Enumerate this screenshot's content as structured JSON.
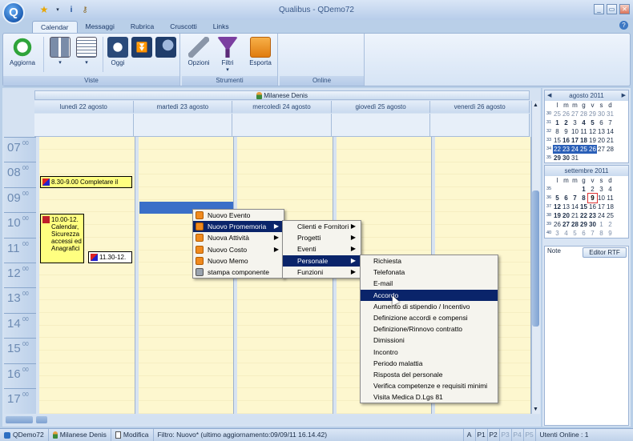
{
  "app": {
    "title": "Qualibus  -  QDemo72",
    "logo_letter": "Q"
  },
  "window_controls": {
    "minimize": "_",
    "restore": "▭",
    "close": "✕"
  },
  "help_label": "?",
  "tabs": [
    {
      "label": "Calendar",
      "active": true
    },
    {
      "label": "Messaggi"
    },
    {
      "label": "Rubrica"
    },
    {
      "label": "Cruscotti"
    },
    {
      "label": "Links"
    }
  ],
  "ribbon": {
    "groups": [
      {
        "label": "Viste"
      },
      {
        "label": "Strumenti"
      },
      {
        "label": "Online"
      }
    ],
    "buttons": {
      "aggiorna": "Aggiorna",
      "oggi": "Oggi",
      "opzioni": "Opzioni",
      "filtri": "Filtri",
      "esporta": "Esporta"
    }
  },
  "resource": "Milanese Denis",
  "days": [
    "lunedì 22 agosto",
    "martedì 23 agosto",
    "mercoledì 24 agosto",
    "giovedì 25 agosto",
    "venerdì 26 agosto"
  ],
  "hours": [
    "07",
    "08",
    "09",
    "10",
    "11",
    "12",
    "13",
    "14",
    "15",
    "16",
    "17"
  ],
  "minutes": "00",
  "events": {
    "e1": "8.30-9.00 Completare il",
    "e2": "10.00-12. Calendar, Sicurezza accessi ed Anagrafici",
    "e3": "11.30-12."
  },
  "context_menu": [
    "Nuovo Evento",
    "Nuovo Promemoria",
    "Nuova Attività",
    "Nuovo Costo",
    "Nuovo Memo",
    "stampa componente"
  ],
  "submenu1": [
    "Clienti e Fornitori",
    "Progetti",
    "Eventi",
    "Personale",
    "Funzioni"
  ],
  "submenu2": [
    "Richiesta",
    "Telefonata",
    "E-mail",
    "Accordo",
    "Aumento di stipendio / Incentivo",
    "Definizione accordi e compensi",
    "Definizione/Rinnovo contratto",
    "Dimissioni",
    "Incontro",
    "Periodo malattia",
    "Risposta del personale",
    "Verifica competenze e requisiti minimi",
    "Visita Medica D.Lgs 81"
  ],
  "mini_cal": {
    "august": {
      "title": "agosto 2011",
      "dow": [
        "l",
        "m",
        "m",
        "g",
        "v",
        "s",
        "d"
      ],
      "weeks": [
        {
          "wk": "30",
          "days": [
            "25",
            "26",
            "27",
            "28",
            "29",
            "30",
            "31"
          ]
        },
        {
          "wk": "31",
          "days": [
            "1",
            "2",
            "3",
            "4",
            "5",
            "6",
            "7"
          ]
        },
        {
          "wk": "32",
          "days": [
            "8",
            "9",
            "10",
            "11",
            "12",
            "13",
            "14"
          ]
        },
        {
          "wk": "33",
          "days": [
            "15",
            "16",
            "17",
            "18",
            "19",
            "20",
            "21"
          ]
        },
        {
          "wk": "34",
          "days": [
            "22",
            "23",
            "24",
            "25",
            "26",
            "27",
            "28"
          ]
        },
        {
          "wk": "35",
          "days": [
            "29",
            "30",
            "31",
            "",
            "",
            "",
            ""
          ]
        }
      ]
    },
    "september": {
      "title": "settembre 2011",
      "dow": [
        "l",
        "m",
        "m",
        "g",
        "v",
        "s",
        "d"
      ],
      "weeks": [
        {
          "wk": "35",
          "days": [
            "",
            "",
            "",
            "1",
            "2",
            "3",
            "4"
          ]
        },
        {
          "wk": "36",
          "days": [
            "5",
            "6",
            "7",
            "8",
            "9",
            "10",
            "11"
          ]
        },
        {
          "wk": "37",
          "days": [
            "12",
            "13",
            "14",
            "15",
            "16",
            "17",
            "18"
          ]
        },
        {
          "wk": "38",
          "days": [
            "19",
            "20",
            "21",
            "22",
            "23",
            "24",
            "25"
          ]
        },
        {
          "wk": "39",
          "days": [
            "26",
            "27",
            "28",
            "29",
            "30",
            "1",
            "2"
          ]
        },
        {
          "wk": "40",
          "days": [
            "3",
            "4",
            "5",
            "6",
            "7",
            "8",
            "9"
          ]
        }
      ]
    }
  },
  "notes": {
    "label": "Note",
    "editor_button": "Editor RTF"
  },
  "status": {
    "company": "QDemo72",
    "user": "Milanese Denis",
    "edit": "Modifica",
    "filter": "Filtro: Nuovo* (ultimo aggiornamento:09/09/11 16.14.42)",
    "buttons": [
      "A",
      "P1",
      "P2",
      "P3",
      "P4",
      "P5"
    ],
    "online": "Utenti Online : 1"
  }
}
